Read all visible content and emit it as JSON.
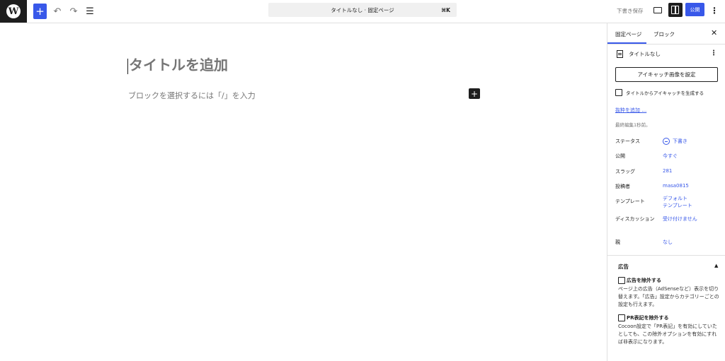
{
  "topbar": {
    "add_symbol": "+",
    "undo_symbol": "↶",
    "redo_symbol": "↷",
    "listview_symbol": "☰",
    "command_text": "タイトルなし · 固定ページ",
    "command_shortcut": "⌘K",
    "save_draft": "下書き保存",
    "publish": "公開",
    "options_symbol": "⋮"
  },
  "editor": {
    "title_placeholder": "タイトルを追加",
    "block_placeholder": "ブロックを選択するには「/」を入力",
    "block_add_symbol": "+"
  },
  "sidebar": {
    "tabs": [
      "固定ページ",
      "ブロック"
    ],
    "close_symbol": "✕",
    "page_title": "タイトルなし",
    "page_menu_symbol": "⋮",
    "featured_image_button": "アイキャッチ画像を設定",
    "generate_featured_label": "タイトルからアイキャッチを生成する",
    "excerpt_link": "抜粋を追加 …",
    "last_edited": "最終編集1秒前。",
    "rows": [
      {
        "label": "ステータス",
        "value": "下書き"
      },
      {
        "label": "公開",
        "value": "今すぐ"
      },
      {
        "label": "スラッグ",
        "value": "281"
      },
      {
        "label": "投稿者",
        "value": "masa0815"
      },
      {
        "label": "テンプレート",
        "value": "デフォルト\nテンプレート"
      },
      {
        "label": "ディスカッション",
        "value": "受け付けません"
      },
      {
        "label": "親",
        "value": "なし"
      }
    ],
    "ad_section": {
      "title": "広告",
      "caret": "▲",
      "exclude_ad_label": "広告を除外する",
      "exclude_ad_desc": "ページ上の広告（AdSenseなど）表示を切り替えます。「広告」設定からカテゴリーごとの設定も行えます。",
      "exclude_pr_label": "PR表記を除外する",
      "exclude_pr_desc": "Cocoon設定で「PR表記」を有効にしていたとしても、この除外オプションを有効にすれば非表示になります。"
    }
  },
  "colors": {
    "accent": "#3858e9",
    "dark": "#1e1e1e",
    "muted": "#757575"
  }
}
